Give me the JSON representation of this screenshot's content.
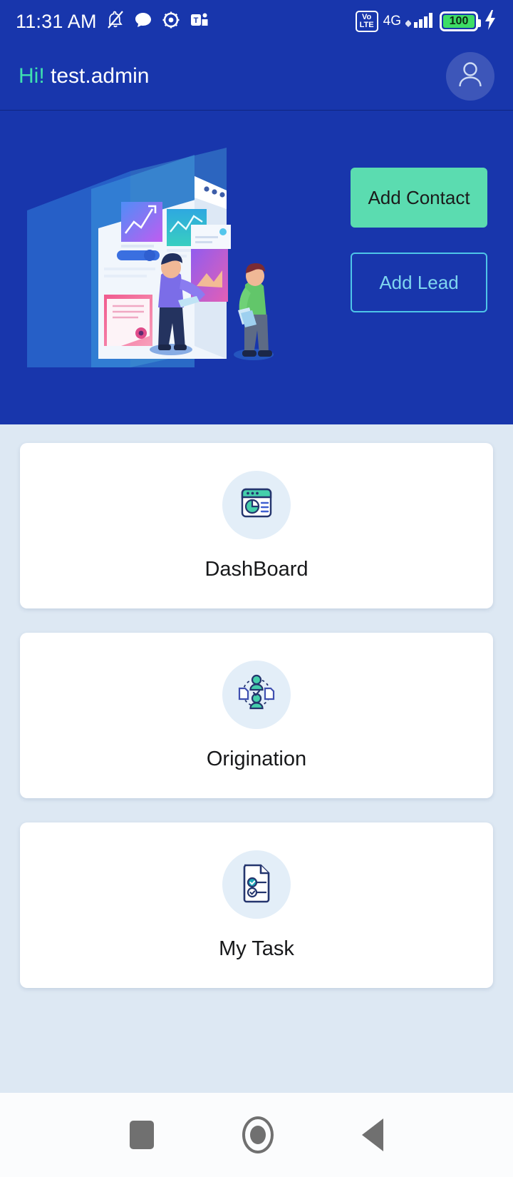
{
  "status_bar": {
    "time": "11:31 AM",
    "icons": [
      "notification-silenced-icon",
      "chat-bubble-icon",
      "gear-icon",
      "teams-icon"
    ],
    "volte_top": "Vo",
    "volte_bottom": "LTE",
    "network": "4G",
    "battery_percent": "100",
    "charging": true
  },
  "header": {
    "greeting_prefix": "Hi!",
    "username": "test.admin",
    "avatar_icon": "user-avatar-icon"
  },
  "hero": {
    "illustration": "crm-dashboard-illustration",
    "primary_button": "Add Contact",
    "outline_button": "Add Lead"
  },
  "menu": {
    "cards": [
      {
        "label": "DashBoard",
        "icon": "dashboard-pie-window-icon"
      },
      {
        "label": "Origination",
        "icon": "origination-network-icon"
      },
      {
        "label": "My Task",
        "icon": "task-checklist-document-icon"
      }
    ]
  },
  "nav_bar": {
    "recents": "recents-square-icon",
    "home": "home-circle-icon",
    "back": "back-triangle-icon"
  },
  "colors": {
    "brand_blue": "#1836ac",
    "accent_mint": "#5bdcb0",
    "accent_cyan": "#4ec5e8",
    "greeting_teal": "#3fe0b0",
    "page_bg": "#dde8f3",
    "card_bg": "#ffffff",
    "icon_circle_bg": "#e3eef8",
    "battery_green": "#3ddc65"
  }
}
